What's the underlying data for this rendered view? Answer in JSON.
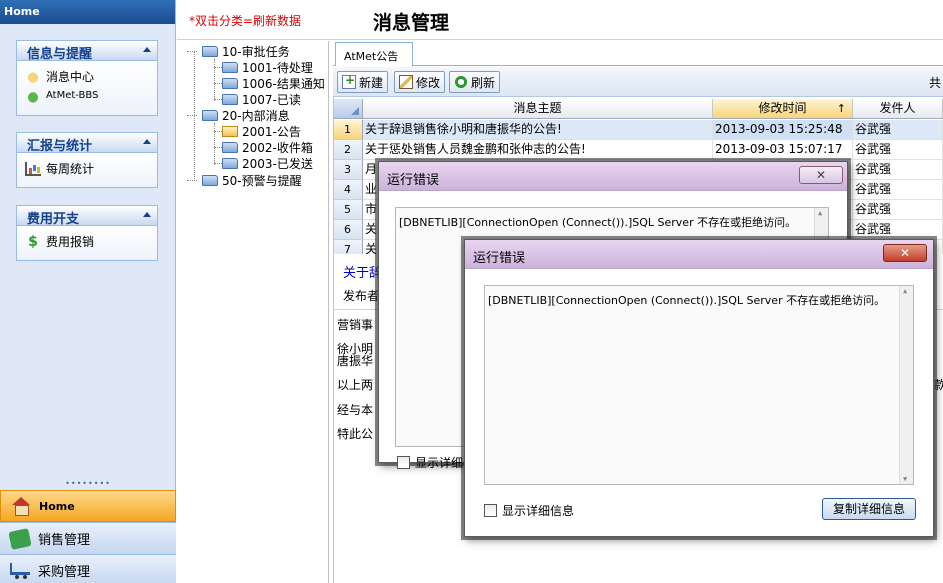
{
  "sidebar": {
    "header": "Home",
    "panels": [
      {
        "title": "信息与提醒",
        "items": [
          {
            "label": "消息中心"
          },
          {
            "label": "AtMet-BBS"
          }
        ]
      },
      {
        "title": "汇报与统计",
        "items": [
          {
            "label": "每周统计"
          }
        ]
      },
      {
        "title": "费用开支",
        "items": [
          {
            "label": "费用报销"
          }
        ]
      }
    ],
    "grip": "••••••••",
    "nav": [
      {
        "label": "Home"
      },
      {
        "label": "销售管理"
      },
      {
        "label": "采购管理"
      }
    ]
  },
  "topbar": {
    "hint": "*双击分类=刷新数据",
    "title": "消息管理"
  },
  "tree": [
    {
      "label": "10-审批任务"
    },
    {
      "label": "1001-待处理"
    },
    {
      "label": "1006-结果通知"
    },
    {
      "label": "1007-已读"
    },
    {
      "label": "20-内部消息"
    },
    {
      "label": "2001-公告"
    },
    {
      "label": "2002-收件箱"
    },
    {
      "label": "2003-已发送"
    },
    {
      "label": "50-预警与提醒"
    }
  ],
  "tabs": [
    {
      "label": "AtMet公告"
    }
  ],
  "toolbar": {
    "new": "新建",
    "edit": "修改",
    "refresh": "刷新",
    "right_text": "共"
  },
  "grid": {
    "columns": [
      "消息主题",
      "修改时间",
      "发件人"
    ],
    "sort_indicator": "↑",
    "rows": [
      {
        "n": "1",
        "subject": "关于辞退销售徐小明和唐振华的公告!",
        "time": "2013-09-03 15:25:48",
        "sender": "谷武强"
      },
      {
        "n": "2",
        "subject": "关于惩处销售人员魏金鹏和张仲志的公告!",
        "time": "2013-09-03 15:07:17",
        "sender": "谷武强"
      },
      {
        "n": "3",
        "subject": "月",
        "time": "",
        "sender": "谷武强"
      },
      {
        "n": "4",
        "subject": "业",
        "time": "",
        "sender": "谷武强"
      },
      {
        "n": "5",
        "subject": "市",
        "time": "",
        "sender": "谷武强"
      },
      {
        "n": "6",
        "subject": "关",
        "time": "",
        "sender": "谷武强"
      },
      {
        "n": "7",
        "subject": "关",
        "time": "",
        "sender": ""
      }
    ]
  },
  "detail": {
    "title": "关于辞",
    "publisher": "发布者",
    "lines": [
      "营销事",
      "徐小明",
      "唐振华",
      "以上两",
      "经与本",
      "特此公"
    ],
    "right_fragment": "款"
  },
  "dialog_back": {
    "title": "运行错误",
    "close": "✕",
    "message": "[DBNETLIB][ConnectionOpen (Connect()).]SQL Server 不存在或拒绝访问。",
    "checkbox": "显示详细"
  },
  "dialog_front": {
    "title": "运行错误",
    "close": "✕",
    "message": "[DBNETLIB][ConnectionOpen (Connect()).]SQL Server 不存在或拒绝访问。",
    "checkbox": "显示详细信息",
    "copy_button": "复制详细信息"
  }
}
